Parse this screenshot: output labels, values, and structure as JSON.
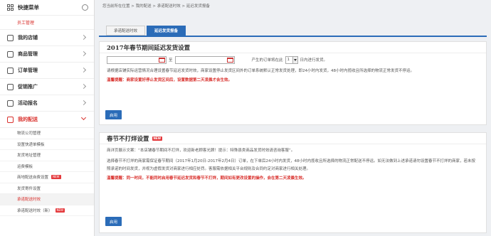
{
  "sidebar": {
    "header": "快捷菜单",
    "staff": "员工管理",
    "groups": [
      {
        "label": "我的店铺"
      },
      {
        "label": "商品管理"
      },
      {
        "label": "订单管理"
      },
      {
        "label": "促销推广"
      },
      {
        "label": "活动报名"
      },
      {
        "label": "我的配送"
      }
    ],
    "sub_items": [
      {
        "label": "物流公司管理"
      },
      {
        "label": "设置快递单模板"
      },
      {
        "label": "发货地址管理"
      },
      {
        "label": "运费模板"
      },
      {
        "label": "商地配送自费设置",
        "badge": "NEW"
      },
      {
        "label": "发货寄件设置"
      },
      {
        "label": "承诺配送时效"
      },
      {
        "label": "承诺配送时效（新）",
        "badge": "NEW"
      }
    ]
  },
  "breadcrumb": "您当前所在位置 > 我的配送 > 承诺配送时效 > 延迟发货报备",
  "tabs": [
    "承诺配送时效",
    "延迟发货报备"
  ],
  "section1": {
    "title": "2017年春节期间延迟发货设置",
    "date_sep": "至",
    "order_label": "产生的订单将在此",
    "select_value": "1",
    "after_label": "日内进行发货。",
    "note": "请根据店铺实际运营情况合理设置春节延迟发货时效，商家设置停止发货区间外的订单系统默认正常发货处理，即24小时内发货，48小时内揽收且所选择的物流正常发货不停运。",
    "warning": "温馨提醒：商家设置好停止发货区间后，设置数据第二天凌晨才会生效。",
    "button": "启用"
  },
  "section2": {
    "title": "春节不打烊设置",
    "badge": "NEW",
    "line1": "商详页展示文案：“本店铺春节期间不打烊，欢迎新老顾客光顾！提示：特殊县类商品发货时效请咨询客服”。",
    "note": "选择春节不打烊的商家需保证春节期间（2017年1月20日-2017年2月4日）订单，在下单后24小时内发货，48小时内揽收且所选择的物流正常配送不停运。如无法做到上述承诺请勿设置春节不打烊的商家，若未按照承诺的时间发货，并视为虚假发货对商家进行相应处罚。客服需依据相关平台规则及合同约定对商家进行相关处理。",
    "warning": "温馨提醒：同一时间，不能同时启用春节延迟发货和春节不打烊，期间如有更改设置的操作，会在第二天凌晨生效。",
    "button": "启用"
  },
  "colors": {
    "accent": "#2b6cb8",
    "brand_red": "#d9302c"
  }
}
